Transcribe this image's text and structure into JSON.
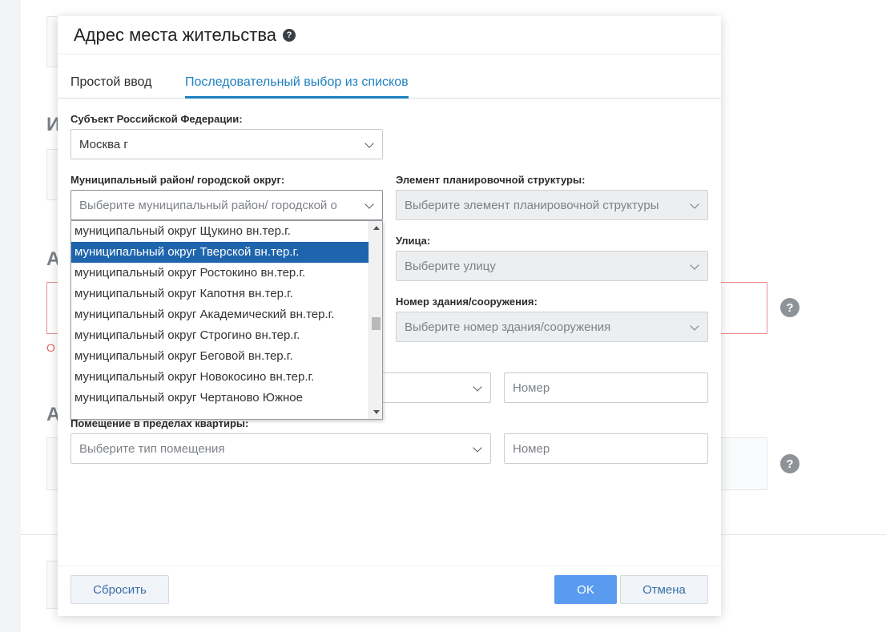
{
  "background": {
    "heading_1": "И",
    "heading_2": "А",
    "heading_3": "А",
    "error_text": "О"
  },
  "modal": {
    "title": "Адрес места жительства",
    "help_glyph": "?",
    "tabs": [
      {
        "label": "Простой ввод",
        "active": false
      },
      {
        "label": "Последовательный выбор из списков",
        "active": true
      }
    ],
    "subject": {
      "label": "Субъект Российской Федерации:",
      "value": "Москва г"
    },
    "municipal": {
      "label": "Муниципальный район/ городской округ:",
      "placeholder": "Выберите муниципальный район/ городской о"
    },
    "planning": {
      "label": "Элемент планировочной структуры:",
      "placeholder": "Выберите элемент планировочной структуры"
    },
    "street": {
      "label": "Улица:",
      "placeholder": "Выберите улицу"
    },
    "building": {
      "label": "Номер здания/сооружения:",
      "placeholder": "Выберите номер здания/сооружения"
    },
    "extra_row": {
      "number_placeholder": "Номер"
    },
    "premises": {
      "label": "Помещение в пределах квартиры:",
      "type_placeholder": "Выберите тип помещения",
      "number_placeholder": "Номер"
    },
    "dropdown_items": [
      "муниципальный округ Щукино вн.тер.г.",
      "муниципальный округ Тверской вн.тер.г.",
      "муниципальный округ Ростокино вн.тер.г.",
      "муниципальный округ Капотня вн.тер.г.",
      "муниципальный округ Академический вн.тер.г.",
      "муниципальный округ Строгино вн.тер.г.",
      "муниципальный округ Беговой вн.тер.г.",
      "муниципальный округ Новокосино вн.тер.г.",
      "муниципальный округ Чертаново Южное"
    ],
    "dropdown_selected_index": 1,
    "buttons": {
      "reset": "Сбросить",
      "ok": "OK",
      "cancel": "Отмена"
    }
  },
  "colors": {
    "accent": "#1d7fc0",
    "selected_item": "#1f65ad",
    "ok_button": "#5a9bf0",
    "error": "#e06767"
  }
}
